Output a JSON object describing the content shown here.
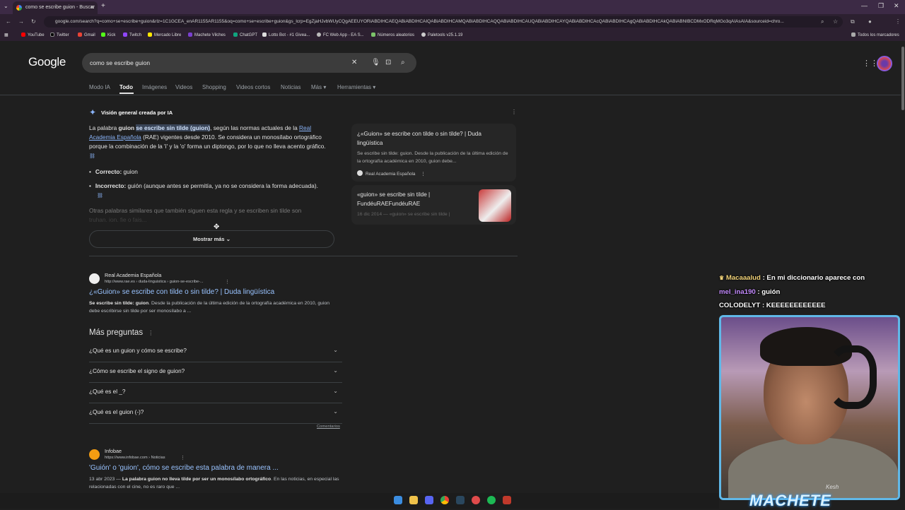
{
  "browser": {
    "tab_title": "como se escribe guion - Buscar",
    "url": "google.com/search?q=como+se+escribe+guion&rlz=1C1GCEA_enAR1155AR1155&oq=como+se+escribe+guion&gs_lcrp=EgZjaHJvbWUyCQgAEEUYORiABDIHCAEQABiABDIHCAIQABiABDIHCAMQABiABDIHCAQQABiABDIHCAUQABiABDIHCAYQABiABDIHCAcQABiABDIHCAgQABiABDIHCAkQABiABNIBCDMxODRqMGo3qAIAsAIA&sourceid=chro...",
    "bookmarks": [
      "YouTube",
      "Twitter",
      "Gmail",
      "Kick",
      "Twitch",
      "Mercado Libre",
      "Machete Vilches",
      "ChatGPT",
      "Lotto Bot - #1 Givea...",
      "FC Web App - EA S...",
      "Números aleatorios",
      "Paletools v25.1.19"
    ],
    "all_bookmarks": "Todos los marcadores"
  },
  "google": {
    "logo": "Google",
    "query": "como se escribe guion",
    "tabs": [
      "Modo IA",
      "Todo",
      "Imágenes",
      "Videos",
      "Shopping",
      "Videos cortos",
      "Noticias",
      "Más ▾",
      "Herramientas ▾"
    ]
  },
  "ai_overview": {
    "header": "Visión general creada por IA",
    "p1_a": "La palabra ",
    "p1_b": "guion",
    "p1_c": "se escribe sin tilde (guion)",
    "p1_d": ", según las normas actuales de la ",
    "p1_link": "Real Academia Española",
    "p1_e": " (RAE) vigentes desde 2010. Se considera un monosílabo ortográfico porque la combinación de la 'i' y la 'o' forma un diptongo, por lo que no lleva acento gráfico.",
    "b1_label": "Correcto:",
    "b1_text": " guion",
    "b2_label": "Incorrecto:",
    "b2_text": " guión (aunque antes se permitía, ya no se considera la forma adecuada).",
    "faded": "Otras palabras similares que también siguen esta regla y se escriben sin tilde son",
    "faded2": "truhan, ion, fie o fais...",
    "show_more": "Mostrar más",
    "card1_title": "¿«Guion» se escribe con tilde o sin tilde? | Duda lingüística",
    "card1_snip": "Se escribe sin tilde: guion. Desde la publicación de la última edición de la ortografía académica en 2010, guion debe...",
    "card1_src": "Real Academia Española",
    "card2_title": "«guion» se escribe sin tilde | FundéuRAEFundéuRAE",
    "card2_snip": "16 dic 2014 — «guion» se escribe sin tilde |"
  },
  "results": [
    {
      "site": "Real Academia Española",
      "url": "http://www.rae.es › duda-linguistica › guion-se-escribe-...",
      "title": "¿«Guion» se escribe con tilde o sin tilde? | Duda lingüística",
      "snip_bold": "Se escribe sin tilde: guion",
      "snip": ". Desde la publicación de la última edición de la ortografía académica en 2010, guion debe escribirse sin tilde por ser monosílabo a ..."
    },
    {
      "site": "Infobae",
      "url": "https://www.infobae.com › Noticias",
      "title": "'Guión' o 'guion', cómo se escribe esta palabra de manera ...",
      "snip_date": "13 abr 2023 — ",
      "snip_bold": "La palabra guion no lleva tilde por ser un monosílabo ortográfico",
      "snip": ". En las noticias, en especial las relacionadas con el cine, no es raro que ..."
    }
  ],
  "people_also_ask": {
    "title": "Más preguntas",
    "questions": [
      "¿Qué es un guion y cómo se escribe?",
      "¿Cómo se escribe el signo de guion?",
      "¿Qué es el _?",
      "¿Qué es el guion (-)?"
    ],
    "feedback": "Comentarios"
  },
  "chat": [
    {
      "user": "Macaaalud",
      "msg": " : En mi diccionario aparece con"
    },
    {
      "user": "mel_ina190",
      "msg": " : guión"
    },
    {
      "user": "COLODELYT",
      "msg": " : KEEEEEEEEEEEE"
    }
  ],
  "stream": {
    "brand": "MACHETE",
    "signature": "Kesh"
  },
  "colors": {
    "link": "#8ab4f8",
    "highlight": "#394457",
    "cam_border": "#60b8e8"
  }
}
